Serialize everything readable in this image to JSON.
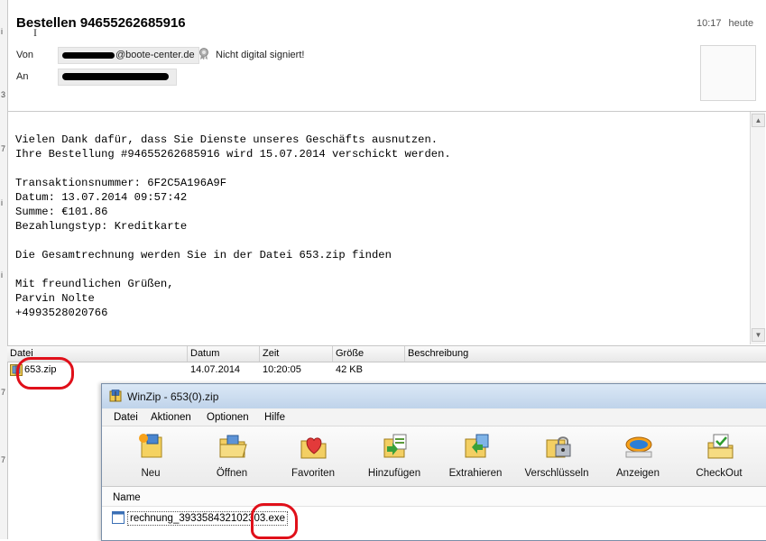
{
  "message": {
    "subject": "Bestellen 94655262685916",
    "time": "10:17",
    "day": "heute",
    "from_label": "Von",
    "from_domain": "@boote-center.de",
    "to_label": "An",
    "signature_status": "Nicht digital signiert!",
    "body_lines": [
      "Vielen Dank dafür, dass Sie Dienste unseres Geschäfts ausnutzen.",
      "Ihre Bestellung #94655262685916 wird 15.07.2014 verschickt werden.",
      "",
      "Transaktionsnummer: 6F2C5A196A9F",
      "Datum: 13.07.2014 09:57:42",
      "Summe: €101.86",
      "Bezahlungstyp: Kreditkarte",
      "",
      "Die Gesamtrechnung werden Sie in der Datei 653.zip finden",
      "",
      "Mit freundlichen Grüßen,",
      "Parvin Nolte",
      "+4993528020766"
    ]
  },
  "attachments": {
    "columns": [
      "Datei",
      "Datum",
      "Zeit",
      "Größe",
      "Beschreibung"
    ],
    "row": {
      "name": "653.zip",
      "date": "14.07.2014",
      "time": "10:20:05",
      "size": "42 KB",
      "description": ""
    }
  },
  "winzip": {
    "title": "WinZip - 653(0).zip",
    "menu": [
      "Datei",
      "Aktionen",
      "Optionen",
      "Hilfe"
    ],
    "toolbar": [
      "Neu",
      "Öffnen",
      "Favoriten",
      "Hinzufügen",
      "Extrahieren",
      "Verschlüsseln",
      "Anzeigen",
      "CheckOut"
    ],
    "list_header": "Name",
    "file": "rechnung_393358432102303.exe"
  },
  "left_strip_marks": [
    "i",
    "3",
    "7",
    "i",
    "i",
    "7",
    "7"
  ],
  "colors": {
    "annotation": "#e0101a",
    "title_bar": "#c9dbef"
  },
  "icons": [
    "seal-icon",
    "zip-file-icon",
    "winzip-icon",
    "new-icon",
    "open-folder-icon",
    "favorites-icon",
    "add-icon",
    "extract-icon",
    "encrypt-icon",
    "view-icon",
    "checkout-icon",
    "exe-file-icon"
  ]
}
